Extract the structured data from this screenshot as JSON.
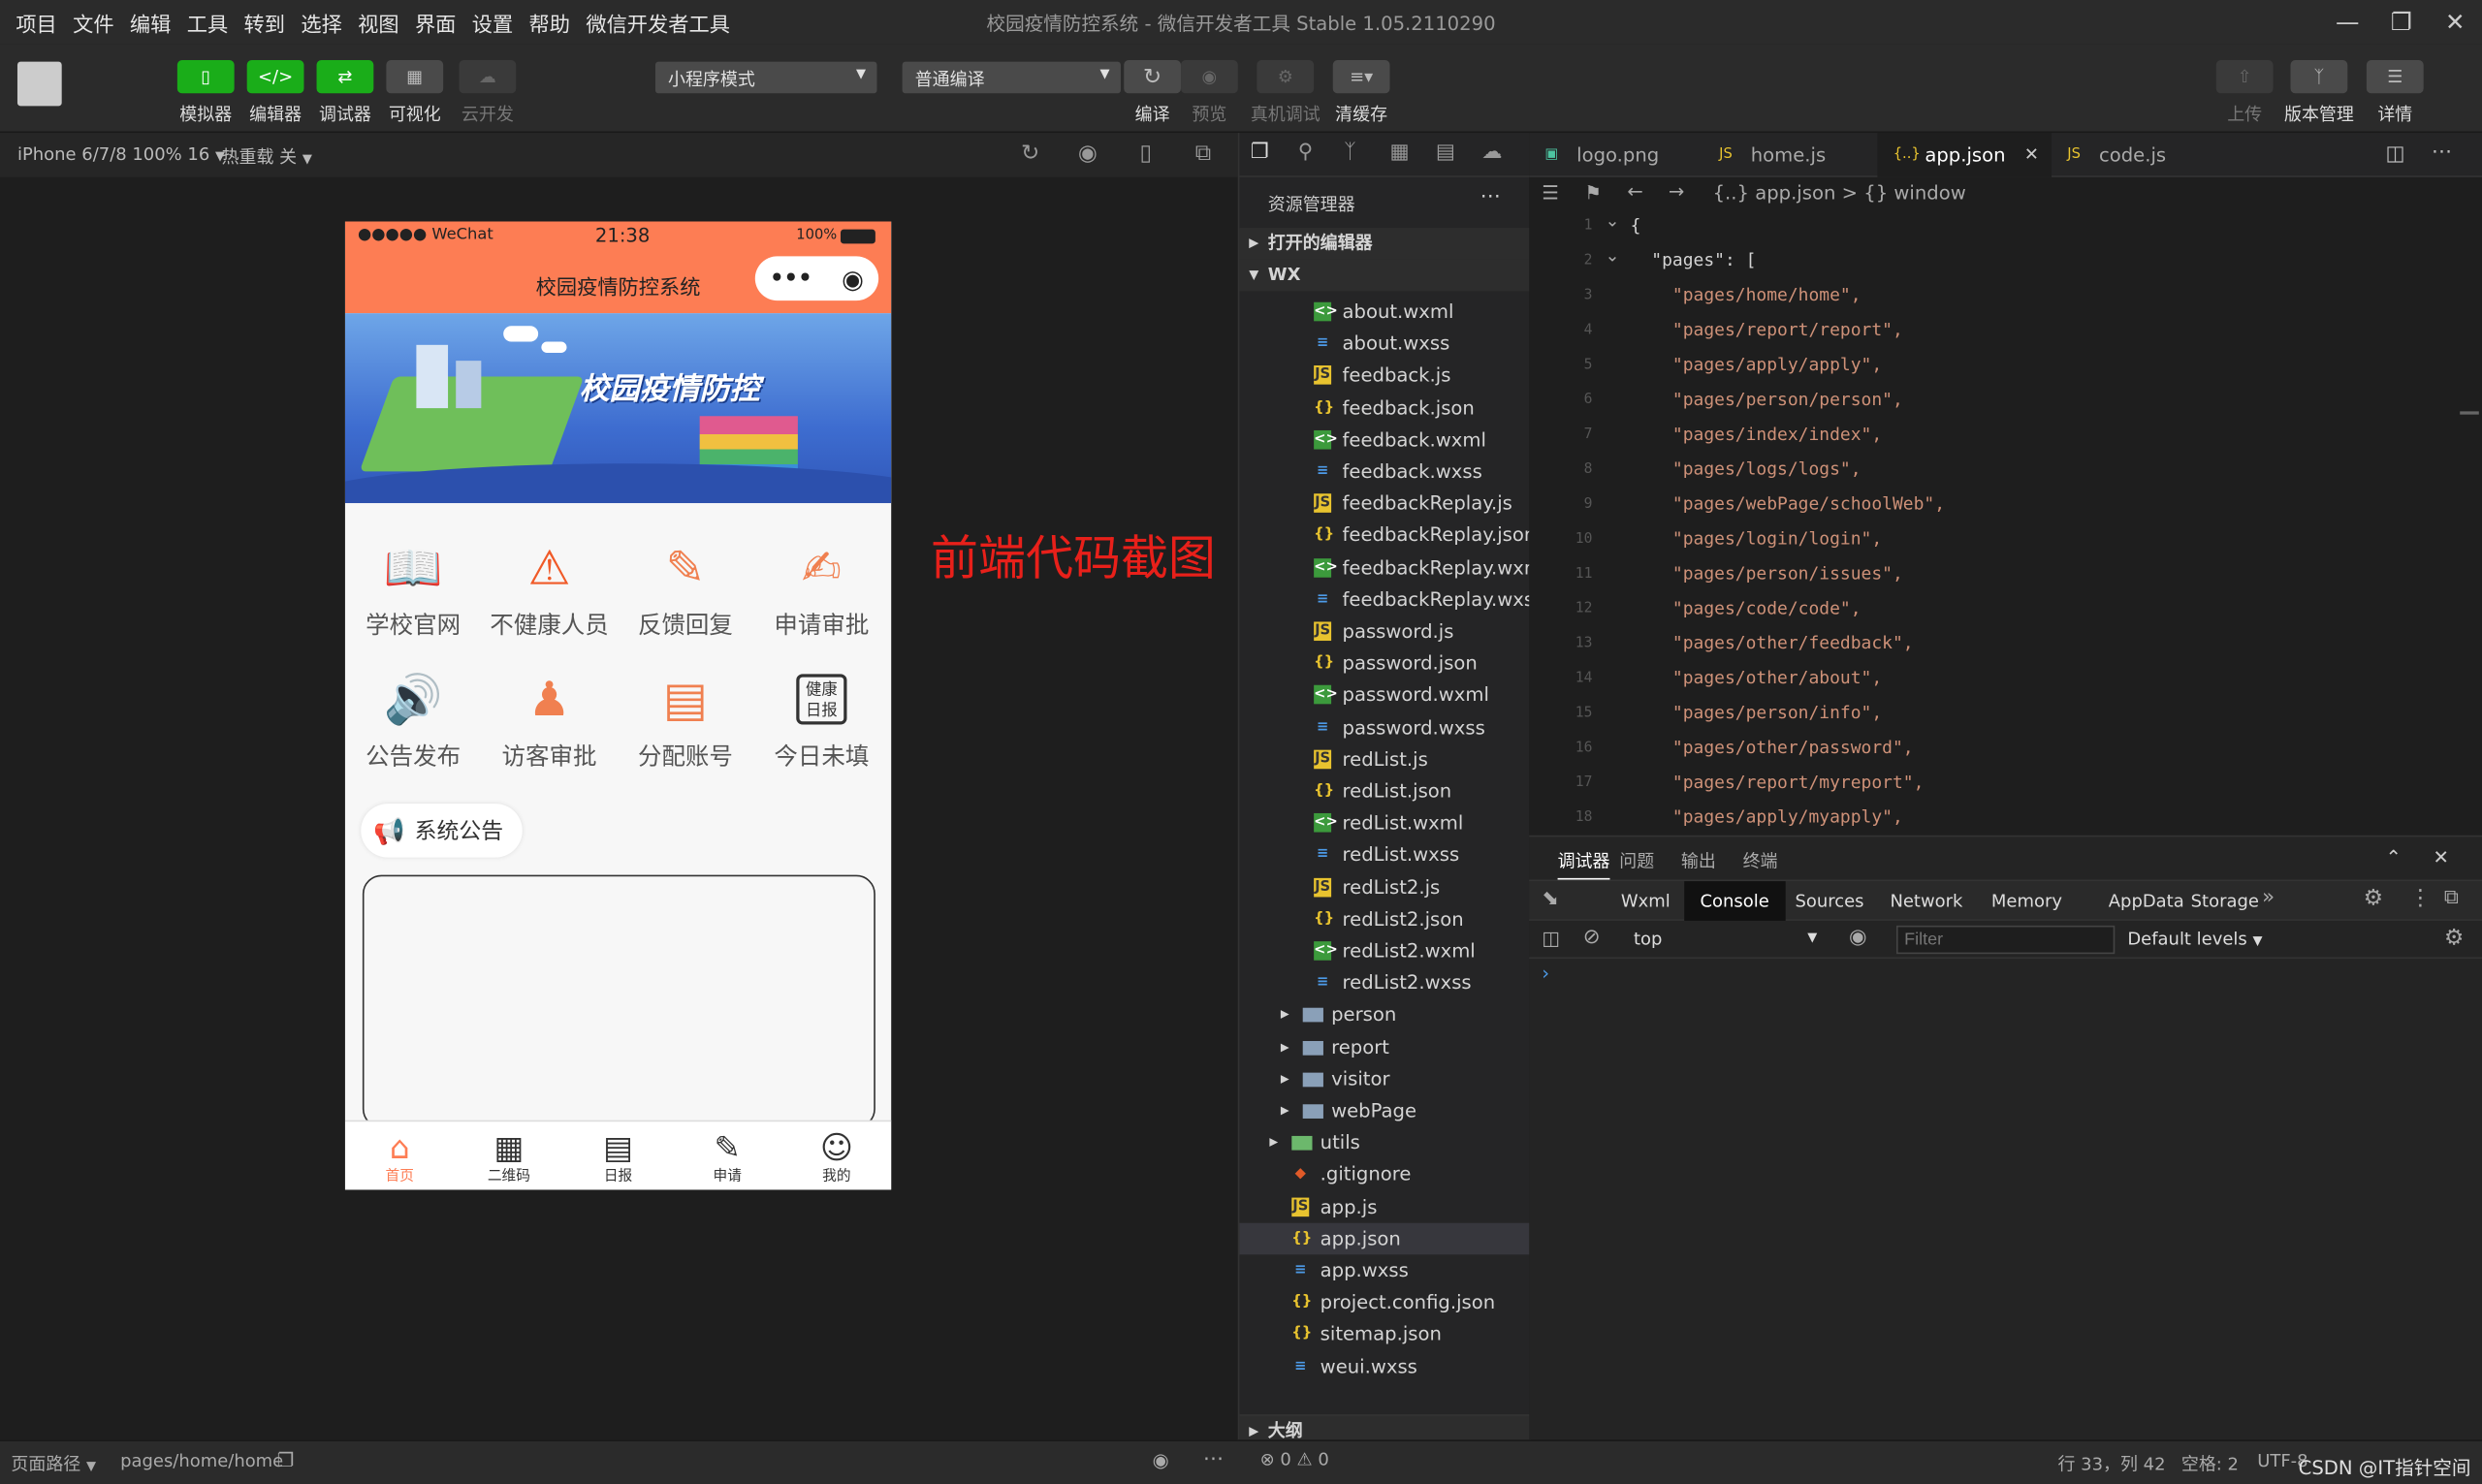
{
  "menubar": {
    "items": [
      "项目",
      "文件",
      "编辑",
      "工具",
      "转到",
      "选择",
      "视图",
      "界面",
      "设置",
      "帮助",
      "微信开发者工具"
    ],
    "title": "校园疫情防控系统 - 微信开发者工具 Stable 1.05.2110290"
  },
  "toolbar": {
    "simulator": "模拟器",
    "editor": "编辑器",
    "debugger": "调试器",
    "visual": "可视化",
    "cloud": "云开发",
    "mode_select": "小程序模式",
    "compile_select": "普通编译",
    "compile": "编译",
    "preview": "预览",
    "real_debug": "真机调试",
    "clear_cache": "清缓存",
    "upload": "上传",
    "version": "版本管理",
    "details": "详情"
  },
  "subbar": {
    "device": "iPhone 6/7/8 100% 16",
    "hot_reload": "热重载 关"
  },
  "phone": {
    "carrier": "●●●●● WeChat",
    "time": "21:38",
    "battery": "100%",
    "title": "校园疫情防控系统",
    "banner_text": "校园疫情防控",
    "grid": [
      "学校官网",
      "不健康人员",
      "反馈回复",
      "申请审批",
      "公告发布",
      "访客审批",
      "分配账号",
      "今日未填"
    ],
    "notice_label": "系统公告",
    "tabs": [
      "首页",
      "二维码",
      "日报",
      "申请",
      "我的"
    ],
    "daily_icon_text": "健康日报"
  },
  "annotation": "前端代码截图",
  "explorer": {
    "title": "资源管理器",
    "open_editors": "打开的编辑器",
    "root": "WX",
    "files": [
      {
        "name": "about.wxml",
        "type": "wxml"
      },
      {
        "name": "about.wxss",
        "type": "wxss"
      },
      {
        "name": "feedback.js",
        "type": "js"
      },
      {
        "name": "feedback.json",
        "type": "json"
      },
      {
        "name": "feedback.wxml",
        "type": "wxml"
      },
      {
        "name": "feedback.wxss",
        "type": "wxss"
      },
      {
        "name": "feedbackReplay.js",
        "type": "js"
      },
      {
        "name": "feedbackReplay.json",
        "type": "json"
      },
      {
        "name": "feedbackReplay.wxml",
        "type": "wxml"
      },
      {
        "name": "feedbackReplay.wxss",
        "type": "wxss"
      },
      {
        "name": "password.js",
        "type": "js"
      },
      {
        "name": "password.json",
        "type": "json"
      },
      {
        "name": "password.wxml",
        "type": "wxml"
      },
      {
        "name": "password.wxss",
        "type": "wxss"
      },
      {
        "name": "redList.js",
        "type": "js"
      },
      {
        "name": "redList.json",
        "type": "json"
      },
      {
        "name": "redList.wxml",
        "type": "wxml"
      },
      {
        "name": "redList.wxss",
        "type": "wxss"
      },
      {
        "name": "redList2.js",
        "type": "js"
      },
      {
        "name": "redList2.json",
        "type": "json"
      },
      {
        "name": "redList2.wxml",
        "type": "wxml"
      },
      {
        "name": "redList2.wxss",
        "type": "wxss"
      }
    ],
    "folders": [
      "person",
      "report",
      "visitor",
      "webPage"
    ],
    "root_items": [
      {
        "name": "utils",
        "type": "folder"
      },
      {
        "name": ".gitignore",
        "type": "git"
      },
      {
        "name": "app.js",
        "type": "js"
      },
      {
        "name": "app.json",
        "type": "json"
      },
      {
        "name": "app.wxss",
        "type": "wxss"
      },
      {
        "name": "project.config.json",
        "type": "json"
      },
      {
        "name": "sitemap.json",
        "type": "json"
      },
      {
        "name": "weui.wxss",
        "type": "wxss"
      }
    ],
    "outline": "大纲"
  },
  "editor": {
    "tabs": [
      "logo.png",
      "home.js",
      "app.json",
      "code.js"
    ],
    "breadcrumb": "{..} app.json > {} window",
    "lines": [
      "{",
      "  \"pages\": [",
      "    \"pages/home/home\",",
      "    \"pages/report/report\",",
      "    \"pages/apply/apply\",",
      "    \"pages/person/person\",",
      "    \"pages/index/index\",",
      "    \"pages/logs/logs\",",
      "    \"pages/webPage/schoolWeb\",",
      "    \"pages/login/login\",",
      "    \"pages/person/issues\",",
      "    \"pages/code/code\",",
      "    \"pages/other/feedback\",",
      "    \"pages/other/about\",",
      "    \"pages/person/info\",",
      "    \"pages/other/password\",",
      "    \"pages/report/myreport\",",
      "    \"pages/apply/myapply\","
    ]
  },
  "devtools": {
    "panel_tabs": [
      "调试器",
      "问题",
      "输出",
      "终端"
    ],
    "tabs": [
      "Wxml",
      "Console",
      "Sources",
      "Network",
      "Memory",
      "AppData",
      "Storage"
    ],
    "context": "top",
    "filter_placeholder": "Filter",
    "levels": "Default levels"
  },
  "statusbar": {
    "page_path_label": "页面路径",
    "page_path": "pages/home/home",
    "errors": "0",
    "warnings": "0",
    "position": "行 33，列 42",
    "spaces": "空格: 2",
    "encoding": "UTF-8",
    "watermark": "CSDN @IT指针空间"
  },
  "colors": {
    "brand_green": "#1aad19",
    "phone_header": "#fd7d54",
    "annotation_red": "#e8201a",
    "tab_active": "#fd7d54"
  }
}
